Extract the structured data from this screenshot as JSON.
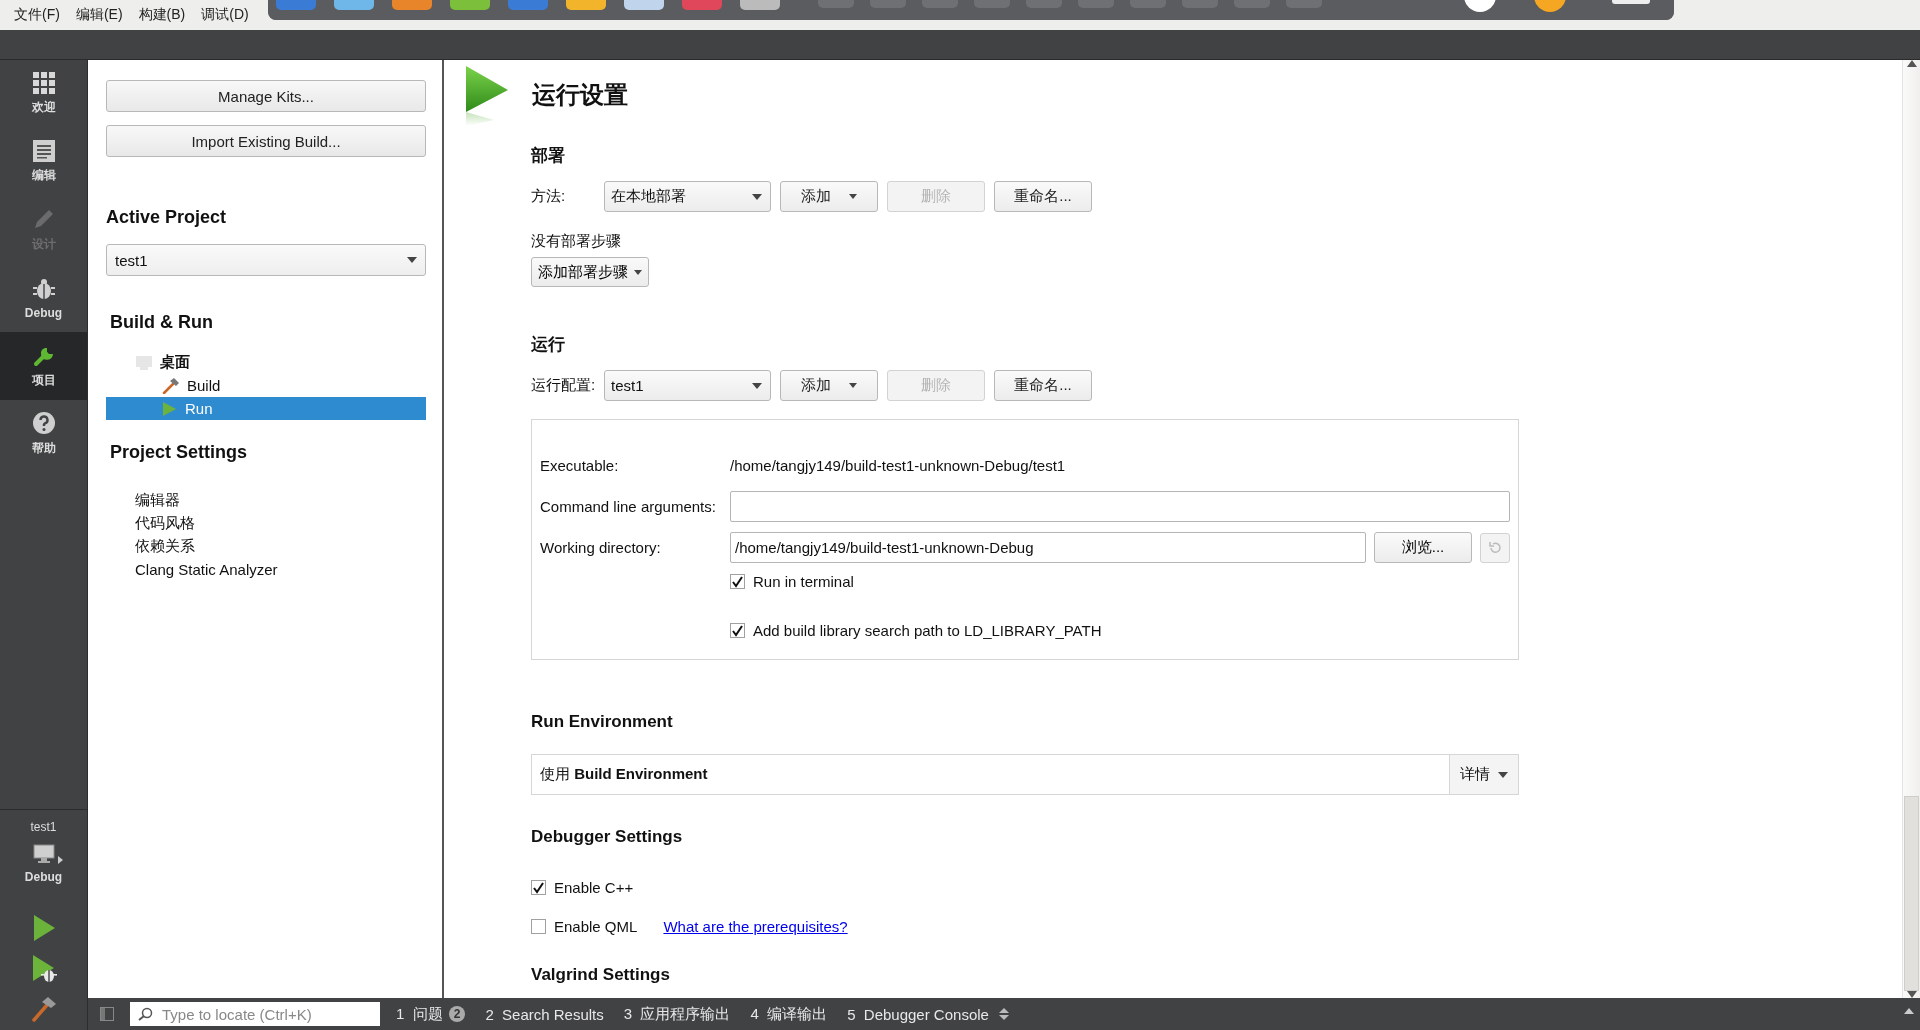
{
  "menu": [
    "文件(F)",
    "编辑(E)",
    "构建(B)",
    "调试(D)"
  ],
  "modes": [
    {
      "label": "欢迎",
      "selected": false,
      "disabled": false
    },
    {
      "label": "编辑",
      "selected": false,
      "disabled": false
    },
    {
      "label": "设计",
      "selected": false,
      "disabled": true
    },
    {
      "label": "Debug",
      "selected": false,
      "disabled": false
    },
    {
      "label": "项目",
      "selected": true,
      "disabled": false
    },
    {
      "label": "帮助",
      "selected": false,
      "disabled": false
    }
  ],
  "kit": {
    "project": "test1",
    "mode": "Debug"
  },
  "left_panel": {
    "buttons": [
      "Manage Kits...",
      "Import Existing Build..."
    ],
    "active_project": {
      "heading": "Active Project",
      "value": "test1"
    },
    "build_run": {
      "heading": "Build & Run",
      "tree": [
        {
          "label": "桌面",
          "children": [
            {
              "label": "Build",
              "kind": "build",
              "selected": false
            },
            {
              "label": "Run",
              "kind": "run",
              "selected": true
            }
          ]
        }
      ]
    },
    "project_settings": {
      "heading": "Project Settings",
      "items": [
        "编辑器",
        "代码风格",
        "依赖关系",
        "Clang Static Analyzer"
      ]
    }
  },
  "main": {
    "title": "运行设置",
    "deploy": {
      "heading": "部署",
      "method_label": "方法:",
      "method_value": "在本地部署",
      "buttons": [
        {
          "label": "添加",
          "kind": "menu",
          "disabled": false
        },
        {
          "label": "删除",
          "kind": "plain",
          "disabled": true
        },
        {
          "label": "重命名...",
          "kind": "plain",
          "disabled": false
        }
      ],
      "empty_text": "没有部署步骤",
      "add_step": "添加部署步骤"
    },
    "run": {
      "heading": "运行",
      "config_label": "运行配置:",
      "config_value": "test1",
      "buttons": [
        {
          "label": "添加",
          "kind": "menu",
          "disabled": false
        },
        {
          "label": "删除",
          "kind": "plain",
          "disabled": true
        },
        {
          "label": "重命名...",
          "kind": "plain",
          "disabled": false
        }
      ],
      "executable_label": "Executable:",
      "executable": "/home/tangjy149/build-test1-unknown-Debug/test1",
      "args_label": "Command line arguments:",
      "working_dir_label": "Working directory:",
      "working_dir": "/home/tangjy149/build-test1-unknown-Debug",
      "browse": "浏览...",
      "checkboxes": [
        {
          "label": "Run in terminal",
          "checked": true
        },
        {
          "label": "Add build library search path to LD_LIBRARY_PATH",
          "checked": true
        }
      ]
    },
    "run_environment": {
      "heading": "Run Environment",
      "text": "使用 **Build Environment**",
      "details": "详情"
    },
    "debugger": {
      "heading": "Debugger Settings",
      "checkboxes": [
        {
          "label": "Enable C++",
          "checked": true
        },
        {
          "label": "Enable QML",
          "checked": false,
          "link": "What are the prerequisites?"
        }
      ]
    },
    "valgrind": {
      "heading": "Valgrind Settings"
    }
  },
  "status_bar": {
    "search_placeholder": "Type to locate (Ctrl+K)",
    "tabs": [
      {
        "number": "1",
        "label": "问题",
        "badge": "2"
      },
      {
        "number": "2",
        "label": "Search Results"
      },
      {
        "number": "3",
        "label": "应用程序输出"
      },
      {
        "number": "4",
        "label": "编译输出"
      },
      {
        "number": "5",
        "label": "Debugger Console"
      }
    ]
  }
}
